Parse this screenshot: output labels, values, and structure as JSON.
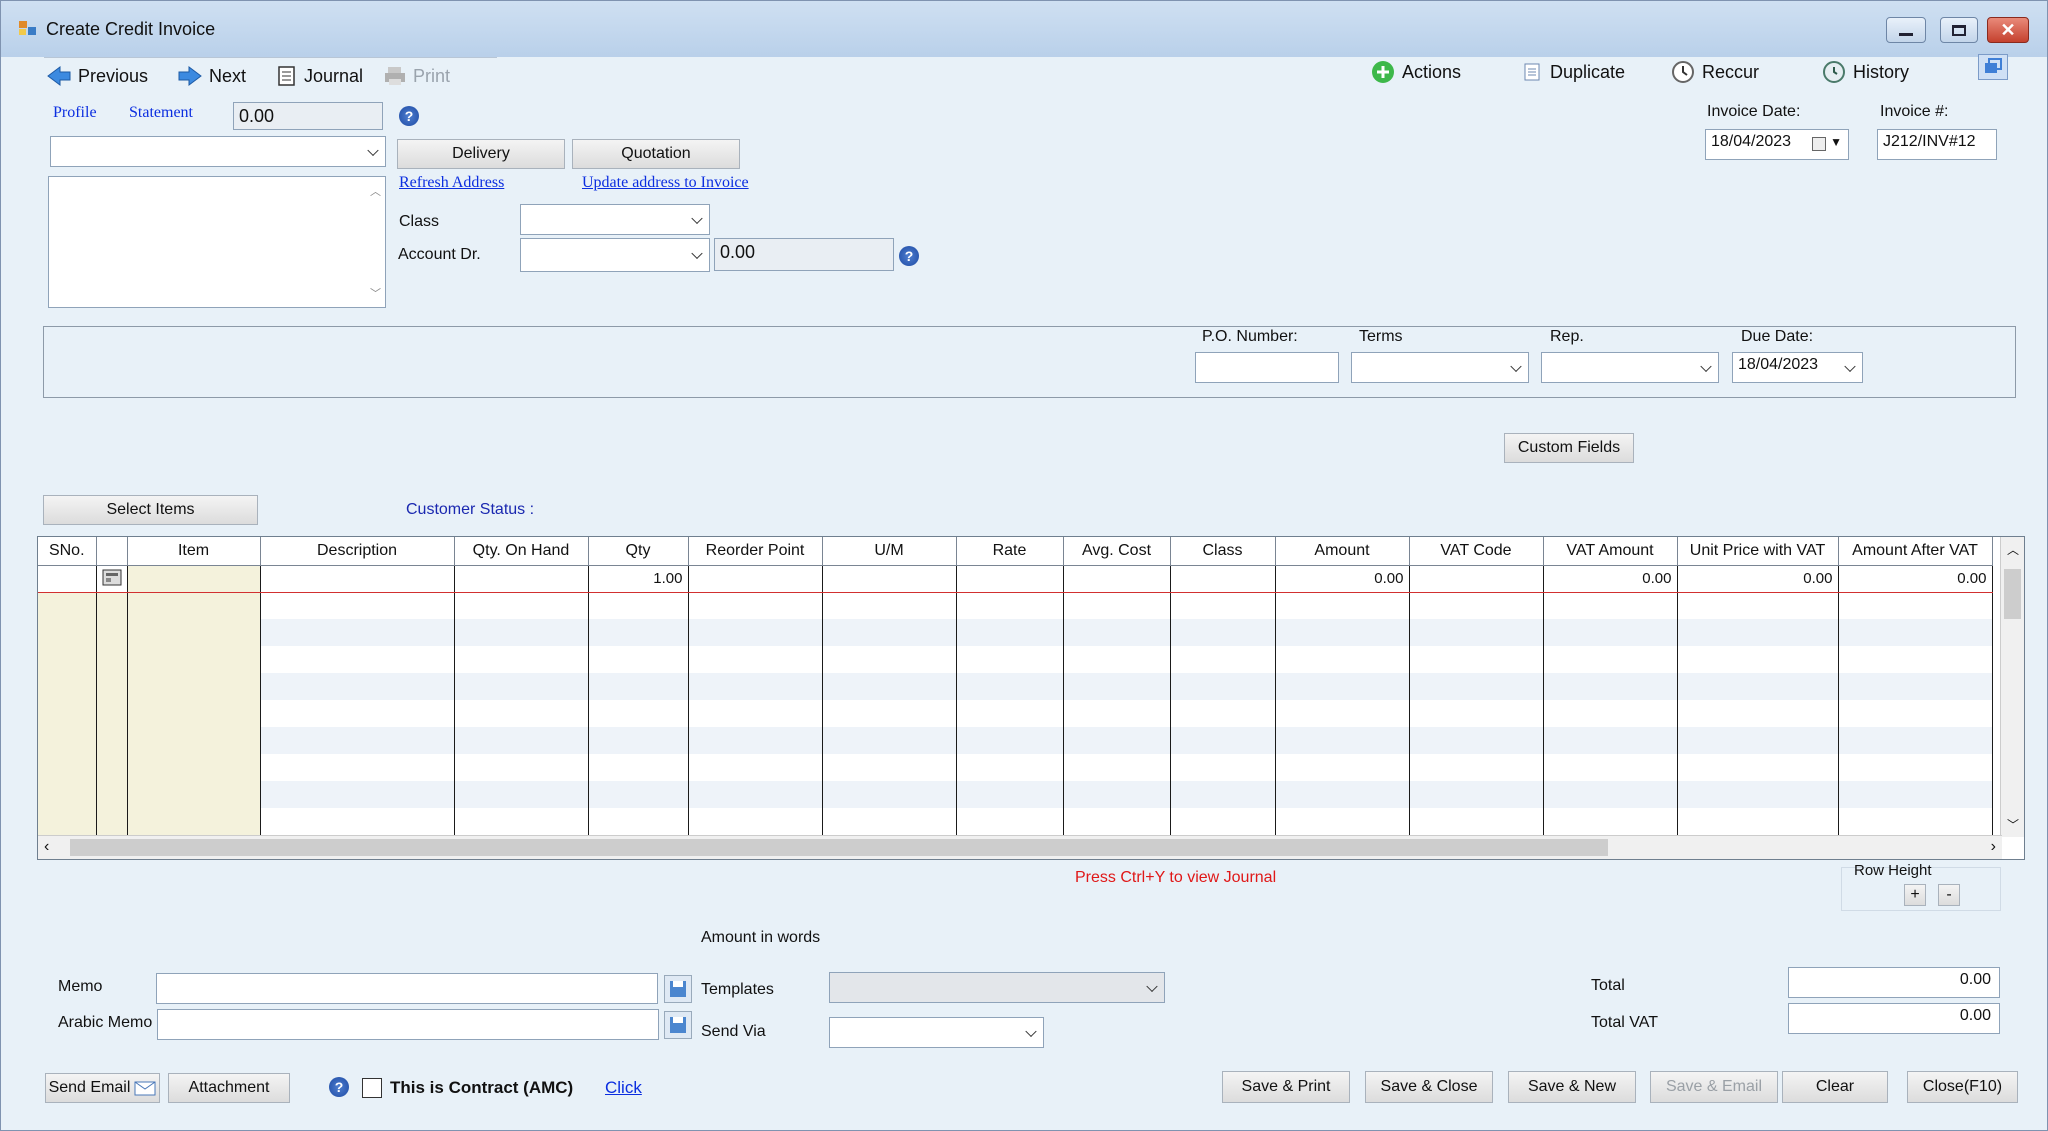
{
  "window": {
    "title": "Create Credit Invoice"
  },
  "toolbar": {
    "previous": "Previous",
    "next": "Next",
    "journal": "Journal",
    "print": "Print"
  },
  "actions": {
    "actions": "Actions",
    "duplicate": "Duplicate",
    "reccur": "Reccur",
    "history": "History"
  },
  "header": {
    "profile": "Profile",
    "statement": "Statement",
    "statement_value": "0.00",
    "delivery": "Delivery",
    "quotation": "Quotation",
    "refresh_address": "Refresh Address",
    "update_address": "Update address to Invoice",
    "class_label": "Class",
    "account_label": "Account Dr.",
    "account_value": "0.00",
    "invoice_date_label": "Invoice Date:",
    "invoice_date": "18/04/2023",
    "invoice_no_label": "Invoice #:",
    "invoice_no": "J212/INV#12"
  },
  "info": {
    "po_label": "P.O. Number:",
    "po_value": "",
    "terms_label": "Terms",
    "rep_label": "Rep.",
    "due_label": "Due Date:",
    "due_value": "18/04/2023",
    "custom_fields": "Custom Fields"
  },
  "items": {
    "select_items": "Select Items",
    "customer_status": "Customer Status :"
  },
  "grid": {
    "columns": [
      "SNo.",
      "",
      "Item",
      "Description",
      "Qty. On Hand",
      "Qty",
      "Reorder Point",
      "U/M",
      "Rate",
      "Avg. Cost",
      "Class",
      "Amount",
      "VAT Code",
      "VAT Amount",
      "Unit Price with VAT",
      "Amount After VAT"
    ],
    "row1": {
      "qty": "1.00",
      "amount": "0.00",
      "vat_amount": "0.00",
      "unit_price_vat": "0.00",
      "amount_after_vat": "0.00"
    }
  },
  "journal_hint": "Press Ctrl+Y to view Journal",
  "row_height": {
    "label": "Row Height",
    "plus": "+",
    "minus": "-"
  },
  "footer": {
    "amount_in_words": "Amount in words",
    "memo": "Memo",
    "arabic_memo": "Arabic Memo",
    "templates": "Templates",
    "send_via": "Send Via",
    "total_label": "Total",
    "total": "0.00",
    "total_vat_label": "Total VAT",
    "total_vat": "0.00",
    "send_email": "Send Email",
    "attachment": "Attachment",
    "contract": "This is Contract (AMC)",
    "click": "Click",
    "save_print": "Save & Print",
    "save_close": "Save & Close",
    "save_new": "Save & New",
    "save_email": "Save & Email",
    "clear": "Clear",
    "close": "Close(F10)"
  },
  "colors": {
    "link": "#0b2ee0",
    "hint": "#e01818",
    "window_bg": "#e8f1f8"
  }
}
